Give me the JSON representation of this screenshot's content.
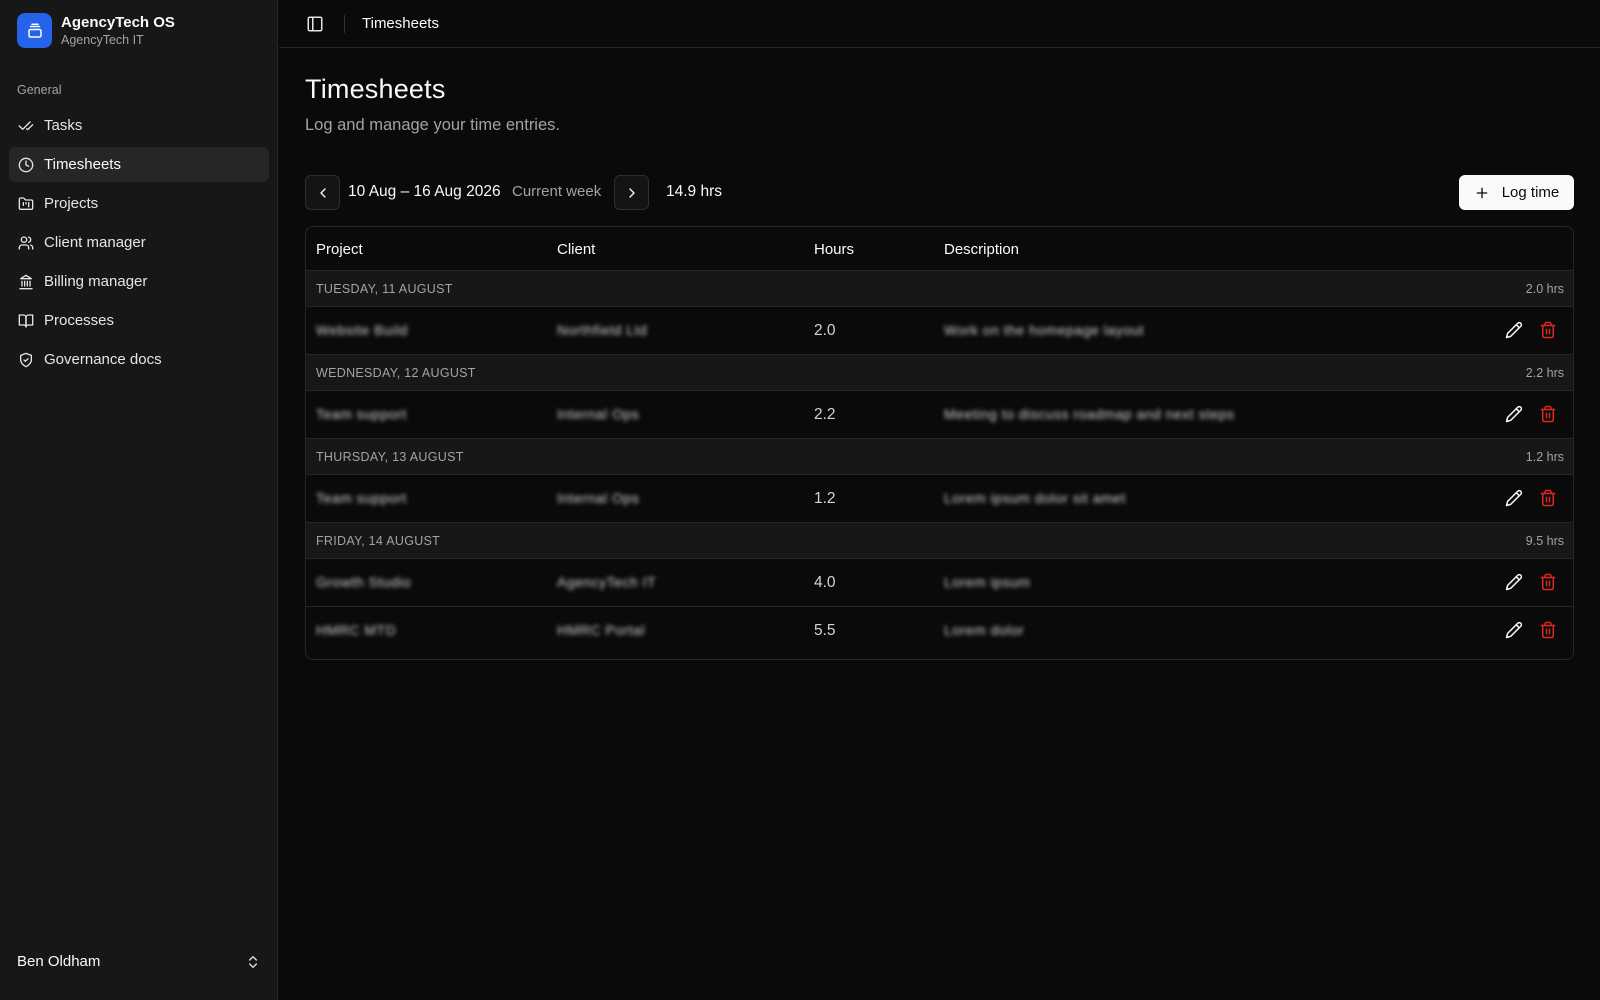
{
  "app": {
    "title": "AgencyTech OS",
    "subtitle": "AgencyTech IT"
  },
  "sidebar": {
    "section_label": "General",
    "items": [
      {
        "label": "Tasks",
        "icon": "check-check-icon"
      },
      {
        "label": "Timesheets",
        "icon": "clock-icon",
        "active": true
      },
      {
        "label": "Projects",
        "icon": "folder-kanban-icon"
      },
      {
        "label": "Client manager",
        "icon": "users-icon"
      },
      {
        "label": "Billing manager",
        "icon": "landmark-icon"
      },
      {
        "label": "Processes",
        "icon": "book-open-icon"
      },
      {
        "label": "Governance docs",
        "icon": "shield-check-icon"
      }
    ],
    "user": {
      "name": "Ben Oldham"
    }
  },
  "header": {
    "breadcrumb": "Timesheets"
  },
  "page": {
    "title": "Timesheets",
    "subtitle": "Log and manage your time entries."
  },
  "toolbar": {
    "date_range": "10 Aug – 16 Aug 2026",
    "week_label": "Current week",
    "total_hours": "14.9 hrs",
    "log_button": "Log time"
  },
  "table": {
    "columns": {
      "project": "Project",
      "client": "Client",
      "hours": "Hours",
      "description": "Description"
    },
    "days": [
      {
        "label": "TUESDAY, 11 AUGUST",
        "total": "2.0 hrs",
        "entries": [
          {
            "project": "Website Build",
            "client": "Northfield Ltd",
            "hours": "2.0",
            "description": "Work on the homepage layout"
          }
        ]
      },
      {
        "label": "WEDNESDAY, 12 AUGUST",
        "total": "2.2 hrs",
        "entries": [
          {
            "project": "Team support",
            "client": "Internal Ops",
            "hours": "2.2",
            "description": "Meeting to discuss roadmap and next steps"
          }
        ]
      },
      {
        "label": "THURSDAY, 13 AUGUST",
        "total": "1.2 hrs",
        "entries": [
          {
            "project": "Team support",
            "client": "Internal Ops",
            "hours": "1.2",
            "description": "Lorem ipsum dolor sit amet"
          }
        ]
      },
      {
        "label": "FRIDAY, 14 AUGUST",
        "total": "9.5 hrs",
        "entries": [
          {
            "project": "Growth Studio",
            "client": "AgencyTech IT",
            "hours": "4.0",
            "description": "Lorem ipsum"
          },
          {
            "project": "HMRC MTD",
            "client": "HMRC Portal",
            "hours": "5.5",
            "description": "Lorem dolor"
          }
        ]
      }
    ]
  },
  "colors": {
    "brand": "#2563eb",
    "danger": "#dc2626",
    "background": "#0a0a0a",
    "sidebar": "#171717"
  }
}
